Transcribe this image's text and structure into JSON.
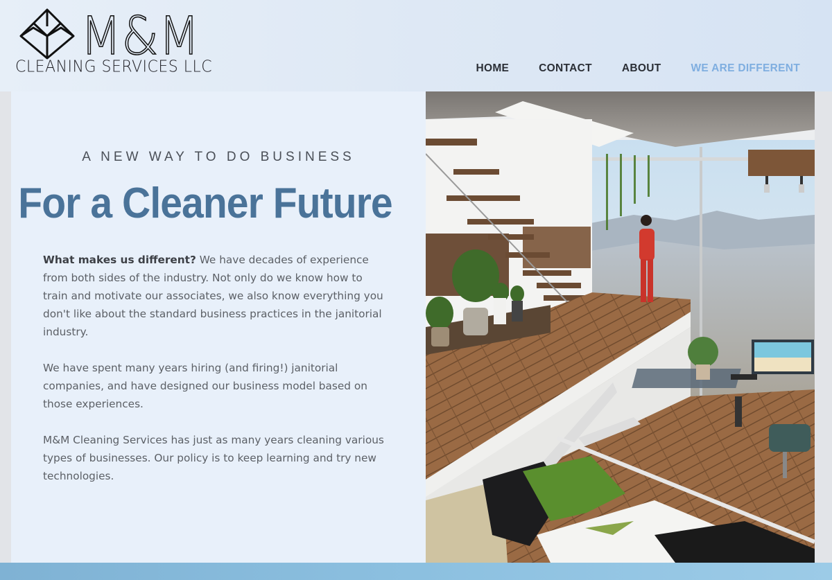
{
  "brand": {
    "name": "M&M",
    "tagline": "CLEANING SERVICES LLC"
  },
  "nav": {
    "items": [
      {
        "label": "HOME",
        "active": false
      },
      {
        "label": "CONTACT",
        "active": false
      },
      {
        "label": "ABOUT",
        "active": false
      },
      {
        "label": "WE ARE DIFFERENT",
        "active": true
      }
    ]
  },
  "hero": {
    "eyebrow": "A NEW WAY TO DO BUSINESS",
    "headline": "For a Cleaner Future",
    "intro_bold": "What makes us different?",
    "intro_rest": " We have decades of experience from both sides of the industry. Not only do we know how to train and motivate our associates, we also know everything you don't like about the standard business practices in the janitorial industry.",
    "paragraph2": "We have spent many years hiring (and firing!) janitorial companies, and have designed our business model based on those experiences.",
    "paragraph3": "M&M Cleaning Services has just as many years cleaning various types of businesses. Our policy is to keep learning and try new technologies."
  },
  "colors": {
    "headline": "#4a7399",
    "nav_active": "#7faee0",
    "footer_bar": "#8cc0e0"
  },
  "icons": {
    "logo_mark": "geometric-cube-house-icon"
  }
}
